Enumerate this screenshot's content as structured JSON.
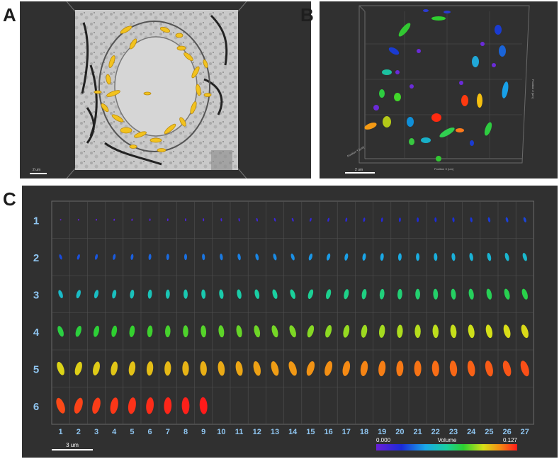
{
  "panels": {
    "a": {
      "label": "A",
      "scale_text": "2 um"
    },
    "b": {
      "label": "B",
      "scale_text": "2 um",
      "axis_x_title": "Position X [um]",
      "axis_y_title": "Position Y [um]",
      "axis_z_title": "Position Z [um]"
    },
    "c": {
      "label": "C",
      "scale_text": "3 um",
      "rows": [
        "1",
        "2",
        "3",
        "4",
        "5",
        "6"
      ],
      "columns": [
        "1",
        "2",
        "3",
        "4",
        "5",
        "6",
        "7",
        "8",
        "9",
        "10",
        "11",
        "12",
        "13",
        "14",
        "15",
        "16",
        "17",
        "18",
        "19",
        "20",
        "21",
        "22",
        "23",
        "24",
        "25",
        "26",
        "27"
      ],
      "row6_count": 9,
      "colorbar": {
        "min": "0.000",
        "max": "0.127",
        "title": "Volume"
      }
    }
  },
  "colors": {
    "panel_bg": "#303030",
    "mito_gold": "#f2c21e",
    "label_blue": "#8fc5f0",
    "grid": "#6a6a6a"
  }
}
